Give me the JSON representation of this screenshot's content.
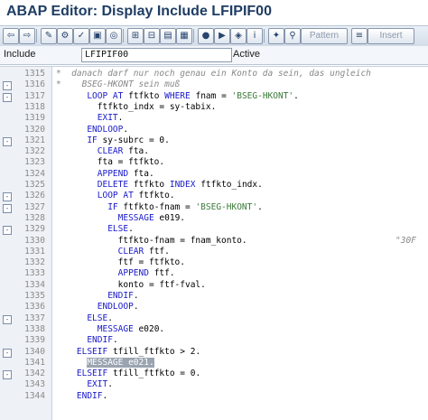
{
  "window": {
    "title": "ABAP Editor: Display Include LFIPIF00"
  },
  "toolbar": {
    "pattern_label": "Pattern",
    "insert_label": "Insert"
  },
  "info": {
    "include_label": "Include",
    "include_value": "LFIPIF00",
    "status": "Active"
  },
  "lines": [
    {
      "n": "1315",
      "segs": [
        [
          "cm",
          "*  danach darf nur noch genau ein Konto da sein, das ungleich"
        ]
      ]
    },
    {
      "n": "1316",
      "segs": [
        [
          "cm",
          "*    BSEG-HKONT sein muß"
        ]
      ]
    },
    {
      "n": "1317",
      "segs": [
        [
          "",
          "      "
        ],
        [
          "kw",
          "LOOP AT"
        ],
        [
          "",
          " ftfkto "
        ],
        [
          "kw",
          "WHERE"
        ],
        [
          "",
          " fnam = "
        ],
        [
          "st",
          "'BSEG-HKONT'"
        ],
        [
          "",
          "."
        ]
      ]
    },
    {
      "n": "1318",
      "segs": [
        [
          "",
          "        ftfkto_indx = sy-tabix."
        ]
      ]
    },
    {
      "n": "1319",
      "segs": [
        [
          "",
          "        "
        ],
        [
          "kw",
          "EXIT"
        ],
        [
          "",
          "."
        ]
      ]
    },
    {
      "n": "1320",
      "segs": [
        [
          "",
          "      "
        ],
        [
          "kw",
          "ENDLOOP"
        ],
        [
          "",
          "."
        ]
      ]
    },
    {
      "n": "1321",
      "segs": [
        [
          "",
          "      "
        ],
        [
          "kw",
          "IF"
        ],
        [
          "",
          " sy-subrc = 0."
        ]
      ]
    },
    {
      "n": "1322",
      "segs": [
        [
          "",
          "        "
        ],
        [
          "kw",
          "CLEAR"
        ],
        [
          "",
          " fta."
        ]
      ]
    },
    {
      "n": "1323",
      "segs": [
        [
          "",
          "        fta = ftfkto."
        ]
      ]
    },
    {
      "n": "1324",
      "segs": [
        [
          "",
          "        "
        ],
        [
          "kw",
          "APPEND"
        ],
        [
          "",
          " fta."
        ]
      ]
    },
    {
      "n": "1325",
      "segs": [
        [
          "",
          "        "
        ],
        [
          "kw",
          "DELETE"
        ],
        [
          "",
          " ftfkto "
        ],
        [
          "kw",
          "INDEX"
        ],
        [
          "",
          " ftfkto_indx."
        ]
      ]
    },
    {
      "n": "1326",
      "segs": [
        [
          "",
          "        "
        ],
        [
          "kw",
          "LOOP AT"
        ],
        [
          "",
          " ftfkto."
        ]
      ]
    },
    {
      "n": "1327",
      "segs": [
        [
          "",
          "          "
        ],
        [
          "kw",
          "IF"
        ],
        [
          "",
          " ftfkto-fnam = "
        ],
        [
          "st",
          "'BSEG-HKONT'"
        ],
        [
          "",
          "."
        ]
      ]
    },
    {
      "n": "1328",
      "segs": [
        [
          "",
          "            "
        ],
        [
          "kw",
          "MESSAGE"
        ],
        [
          "",
          " e019."
        ]
      ]
    },
    {
      "n": "1329",
      "segs": [
        [
          "",
          "          "
        ],
        [
          "kw",
          "ELSE"
        ],
        [
          "",
          "."
        ]
      ]
    },
    {
      "n": "1330",
      "segs": [
        [
          "",
          "            ftfkto-fnam = fnam_konto."
        ]
      ],
      "ann": "\"30F"
    },
    {
      "n": "1331",
      "segs": [
        [
          "",
          "            "
        ],
        [
          "kw",
          "CLEAR"
        ],
        [
          "",
          " ftf."
        ]
      ]
    },
    {
      "n": "1332",
      "segs": [
        [
          "",
          "            ftf = ftfkto."
        ]
      ]
    },
    {
      "n": "1333",
      "segs": [
        [
          "",
          "            "
        ],
        [
          "kw",
          "APPEND"
        ],
        [
          "",
          " ftf."
        ]
      ]
    },
    {
      "n": "1334",
      "segs": [
        [
          "",
          "            konto = ftf-fval."
        ]
      ]
    },
    {
      "n": "1335",
      "segs": [
        [
          "",
          "          "
        ],
        [
          "kw",
          "ENDIF"
        ],
        [
          "",
          "."
        ]
      ]
    },
    {
      "n": "1336",
      "segs": [
        [
          "",
          "        "
        ],
        [
          "kw",
          "ENDLOOP"
        ],
        [
          "",
          "."
        ]
      ]
    },
    {
      "n": "1337",
      "segs": [
        [
          "",
          "      "
        ],
        [
          "kw",
          "ELSE"
        ],
        [
          "",
          "."
        ]
      ]
    },
    {
      "n": "1338",
      "segs": [
        [
          "",
          "        "
        ],
        [
          "kw",
          "MESSAGE"
        ],
        [
          "",
          " e020."
        ]
      ]
    },
    {
      "n": "1339",
      "segs": [
        [
          "",
          "      "
        ],
        [
          "kw",
          "ENDIF"
        ],
        [
          "",
          "."
        ]
      ]
    },
    {
      "n": "1340",
      "segs": [
        [
          "",
          "    "
        ],
        [
          "kw",
          "ELSEIF"
        ],
        [
          "",
          " tfill_ftfkto > 2."
        ]
      ]
    },
    {
      "n": "1341",
      "segs": [
        [
          "",
          "      "
        ],
        [
          "hl",
          "MESSAGE e021."
        ]
      ]
    },
    {
      "n": "1342",
      "segs": [
        [
          "",
          "    "
        ],
        [
          "kw",
          "ELSEIF"
        ],
        [
          "",
          " tfill_ftfkto = 0."
        ]
      ]
    },
    {
      "n": "1343",
      "segs": [
        [
          "",
          "      "
        ],
        [
          "kw",
          "EXIT"
        ],
        [
          "",
          "."
        ]
      ]
    },
    {
      "n": "1344",
      "segs": [
        [
          "",
          "    "
        ],
        [
          "kw",
          "ENDIF"
        ],
        [
          "",
          "."
        ]
      ]
    }
  ]
}
